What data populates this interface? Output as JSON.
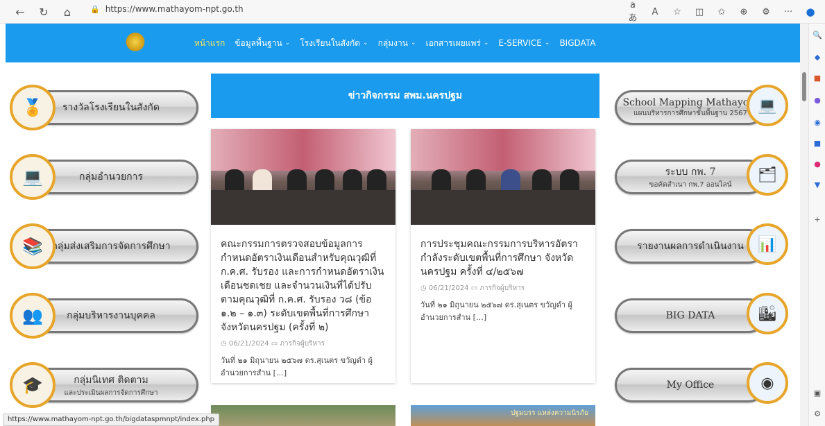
{
  "browser": {
    "url": "https://www.mathayom-npt.go.th",
    "status_url": "https://www.mathayom-npt.go.th/bigdataspmnpt/index.php",
    "icons": [
      "back-icon",
      "refresh-icon",
      "home-icon",
      "lock-icon",
      "read-aloud-icon",
      "aa-icon",
      "favorite-icon",
      "split-icon",
      "favorites-list-icon",
      "collections-icon",
      "extensions-icon",
      "more-icon",
      "copilot-icon"
    ],
    "right_labels": [
      "aあ",
      "A",
      "☆",
      "◫",
      "✩",
      "⊕",
      "⚙",
      "···"
    ]
  },
  "nav": {
    "items": [
      {
        "label": "หน้าแรก",
        "active": true,
        "dropdown": false
      },
      {
        "label": "ข้อมูลพื้นฐาน",
        "active": false,
        "dropdown": true
      },
      {
        "label": "โรงเรียนในสังกัด",
        "active": false,
        "dropdown": true
      },
      {
        "label": "กลุ่มงาน",
        "active": false,
        "dropdown": true
      },
      {
        "label": "เอกสารเผยแพร่",
        "active": false,
        "dropdown": true
      },
      {
        "label": "E-SERVICE",
        "active": false,
        "dropdown": true
      },
      {
        "label": "BIGDATA",
        "active": false,
        "dropdown": false
      }
    ]
  },
  "left_menu": [
    {
      "label": "รางวัลโรงเรียนในสังกัด",
      "sub": "",
      "icon": "medal-icon"
    },
    {
      "label": "กลุ่มอำนวยการ",
      "sub": "",
      "icon": "person-laptop-icon"
    },
    {
      "label": "กลุ่มส่งเสริมการจัดการศึกษา",
      "sub": "",
      "icon": "books-icon"
    },
    {
      "label": "กลุ่มบริหารงานบุคคล",
      "sub": "",
      "icon": "people-icon"
    },
    {
      "label": "กลุ่มนิเทศ ติดตาม",
      "sub": "และประเมินผลการจัดการศึกษา",
      "icon": "graduation-cap-icon"
    }
  ],
  "main": {
    "banner": "ข่าวกิจกรรม สพม.นครปฐม",
    "posts": [
      {
        "title": "คณะกรรมการตรวจสอบข้อมูลการกำหนดอัตราเงินเดือนสำหรับคุณวุฒิที่ ก.ค.ศ. รับรอง และการกำหนดอัตราเงินเดือนชดเชย และจำนวนเงินที่ได้ปรับตามคุณวุฒิที่ ก.ค.ศ. รับรอง ว๘ (ข้อ ๑.๒ – ๑.๓) ระดับเขตพื้นที่การศึกษา จังหวัดนครปฐม (ครั้งที่ ๒)",
        "date": "06/21/2024",
        "category": "ภารกิจผู้บริหาร",
        "excerpt": "วันที่ ๒๑ มิถุนายน ๒๕๖๗ ดร.สุเนตร ขวัญดำ ผู้อำนวยการสำน […]"
      },
      {
        "title": "การประชุมคณะกรรมการบริหารอัตรากำลังระดับเขตพื้นที่การศึกษา จังหวัดนครปฐม ครั้งที่ ๔/๒๕๖๗",
        "date": "06/21/2024",
        "category": "ภารกิจผู้บริหาร",
        "excerpt": "วันที่ ๒๑ มิถุนายน ๒๕๖๗ ดร.สุเนตร ขวัญดำ ผู้อำนวยการสำน […]"
      }
    ],
    "bottom_label": "ปฐมบรร แหล่งความนิรภัย"
  },
  "right_menu": [
    {
      "label": "School Mapping Mathayom",
      "sub": "แผนบริหารการศึกษาขั้นพื้นฐาน 2567",
      "icon": "laptop-person-icon"
    },
    {
      "label": "ระบบ กพ. 7",
      "sub": "ขอคัดสำเนา กพ.7 ออนไลน์",
      "icon": "document-folder-icon"
    },
    {
      "label": "รายงานผลการดำเนินงาน",
      "sub": "",
      "icon": "report-icon"
    },
    {
      "label": "BIG DATA",
      "sub": "",
      "icon": "bigdata-icon"
    },
    {
      "label": "My Office",
      "sub": "",
      "icon": "seal-icon"
    }
  ],
  "colors": {
    "brand": "#1a9bee",
    "active_menu": "#ffe65a",
    "badge_ring": "#e7a52a"
  }
}
